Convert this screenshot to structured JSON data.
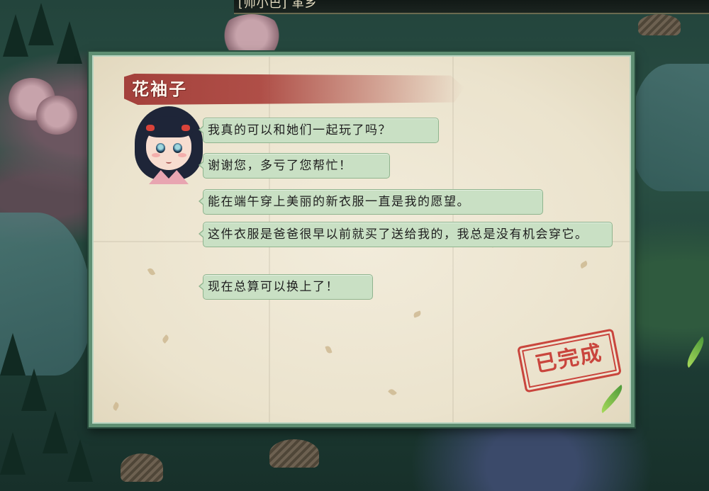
{
  "top_bar": {
    "text": "[帅小巴] 革乡"
  },
  "dialog": {
    "speaker_name": "花袖子",
    "avatar": "girl-portrait-icon",
    "messages": [
      "我真的可以和她们一起玩了吗？",
      "谢谢您，多亏了您帮忙！",
      "能在端午穿上美丽的新衣服一直是我的愿望。",
      "这件衣服是爸爸很早以前就买了送给我的，我总是没有机会穿它。",
      "现在总算可以换上了！"
    ],
    "stamp_text": "已完成"
  },
  "colors": {
    "panel_border": "#5f8f73",
    "bubble_fill": "#c9e0c4",
    "banner_red": "#a03834",
    "stamp_red": "#c6352e"
  }
}
